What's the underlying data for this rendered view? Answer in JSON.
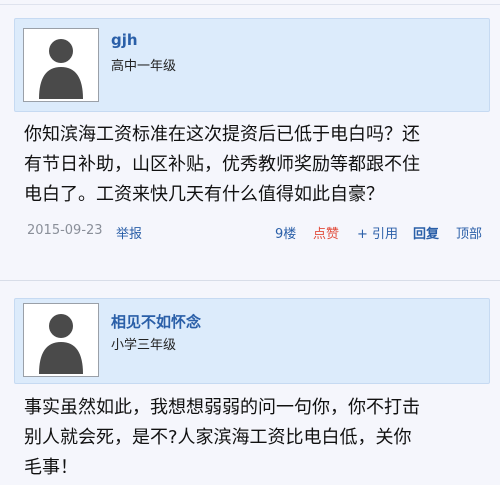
{
  "posts": [
    {
      "username": "gjh",
      "grade": "高中一年级",
      "lines": [
        "你知滨海工资标准在这次提资后已低于电白吗？还",
        "有节日补助，山区补贴，优秀教师奖励等都跟不住",
        "电白了。工资来快几天有什么值得如此自豪？"
      ],
      "meta": {
        "date": "2015-09-23",
        "report": "举报",
        "floor": "9楼",
        "like": "点赞",
        "quote": "+ 引用",
        "reply": "回复",
        "top": "顶部"
      }
    },
    {
      "username": "相见不如怀念",
      "grade": "小学三年级",
      "lines": [
        "事实虽然如此，我想想弱弱的问一句你，你不打击",
        "别人就会死，是不?人家滨海工资比电白低，关你",
        "毛事！"
      ]
    }
  ]
}
